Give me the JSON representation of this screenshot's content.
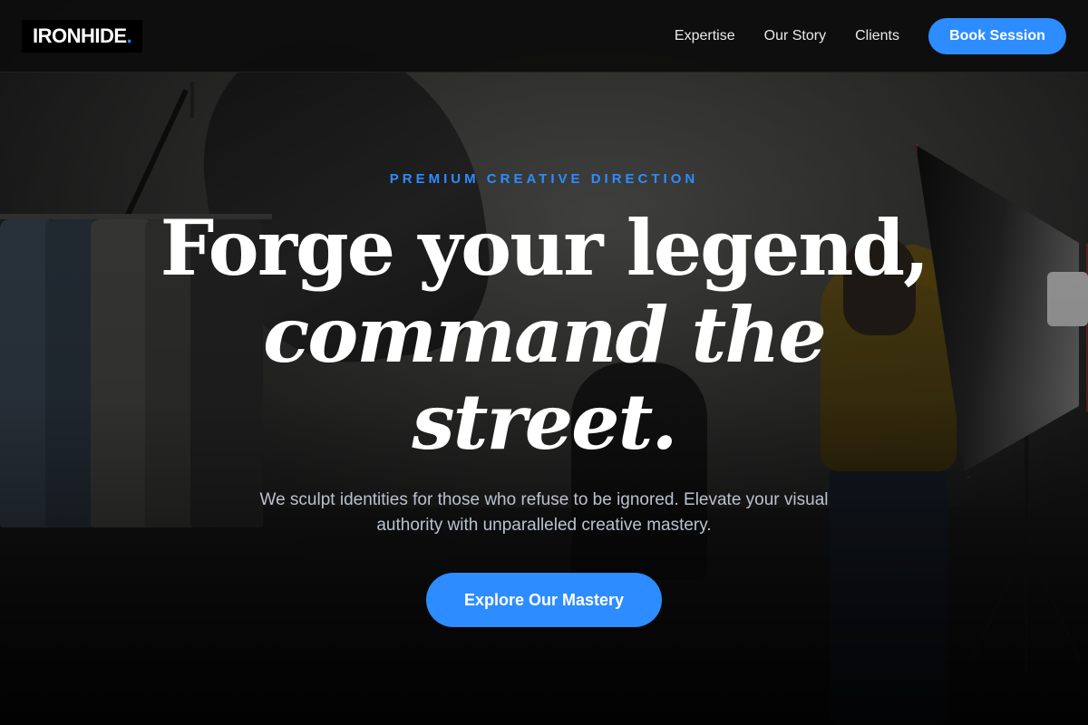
{
  "brand": {
    "name": "IRONHIDE",
    "dot": ".",
    "accent_color": "#2d8cff"
  },
  "nav": {
    "links": [
      "Expertise",
      "Our Story",
      "Clients"
    ],
    "cta_label": "Book Session"
  },
  "hero": {
    "eyebrow": "PREMIUM CREATIVE DIRECTION",
    "headline_line1": "Forge your legend,",
    "headline_line2": "command the",
    "headline_line3": "street.",
    "subtitle": "We sculpt identities for those who refuse to be ignored. Elevate your visual authority with unparalleled creative mastery.",
    "cta_label": "Explore Our Mastery"
  }
}
